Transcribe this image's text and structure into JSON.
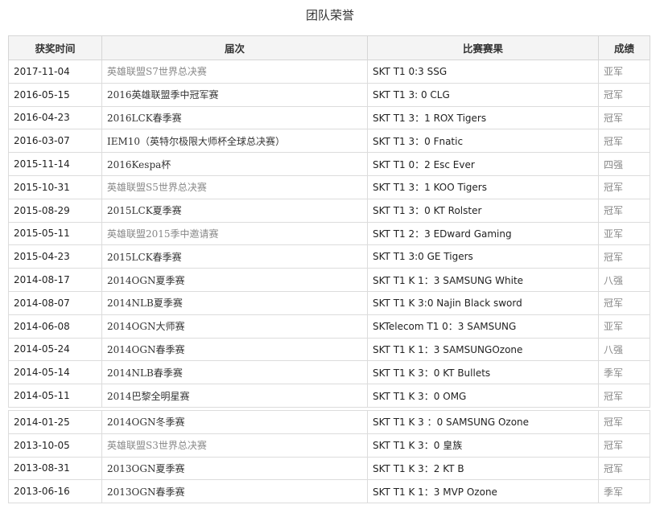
{
  "title": "团队荣誉",
  "headers": {
    "date": "获奖时间",
    "event": "届次",
    "match": "比赛赛果",
    "result": "成绩"
  },
  "rows": [
    {
      "date": "2017-11-04",
      "event": "英雄联盟S7世界总决赛",
      "match": "SKT T1 0:3 SSG",
      "result": "亚军"
    },
    {
      "date": "2016-05-15",
      "event": "2016英雄联盟季中冠军赛",
      "match": "SKT T1 3: 0 CLG",
      "result": "冠军"
    },
    {
      "date": "2016-04-23",
      "event": "2016LCK春季赛",
      "match": "SKT T1 3：1 ROX Tigers",
      "result": "冠军"
    },
    {
      "date": "2016-03-07",
      "event": "IEM10（英特尔极限大师杯全球总决赛）",
      "match": "SKT T1 3：0 Fnatic",
      "result": "冠军"
    },
    {
      "date": "2015-11-14",
      "event": "2016Kespa杯",
      "match": "SKT T1 0：2 Esc Ever",
      "result": "四强"
    },
    {
      "date": "2015-10-31",
      "event": "英雄联盟S5世界总决赛",
      "match": "SKT T1 3：1 KOO Tigers",
      "result": "冠军"
    },
    {
      "date": "2015-08-29",
      "event": "2015LCK夏季赛",
      "match": "SKT T1 3：0 KT Rolster",
      "result": "冠军"
    },
    {
      "date": "2015-05-11",
      "event": "英雄联盟2015季中邀请赛",
      "match": "SKT T1 2：3 EDward Gaming",
      "result": "亚军"
    },
    {
      "date": "2015-04-23",
      "event": "2015LCK春季赛",
      "match": "SKT T1 3:0 GE Tigers",
      "result": "冠军"
    },
    {
      "date": "2014-08-17",
      "event": "2014OGN夏季赛",
      "match": "SKT T1 K 1：3 SAMSUNG White",
      "result": "八强"
    },
    {
      "date": "2014-08-07",
      "event": "2014NLB夏季赛",
      "match": "SKT T1 K 3:0 Najin Black sword",
      "result": "冠军"
    },
    {
      "date": "2014-06-08",
      "event": "2014OGN大师赛",
      "match": "SKTelecom T1 0：3 SAMSUNG",
      "result": "亚军"
    },
    {
      "date": "2014-05-24",
      "event": "2014OGN春季赛",
      "match": "SKT T1 K 1：3 SAMSUNGOzone",
      "result": "八强"
    },
    {
      "date": "2014-05-14",
      "event": "2014NLB春季赛",
      "match": "SKT T1 K 3：0 KT Bullets",
      "result": "季军"
    },
    {
      "date": "2014-05-11",
      "event": "2014巴黎全明星赛",
      "match": "SKT T1 K 3：0 OMG",
      "result": "冠军"
    },
    {
      "date": "2014-01-25",
      "event": "2014OGN冬季赛",
      "match": "SKT T1 K 3 ：0 SAMSUNG Ozone",
      "result": "冠军"
    },
    {
      "date": "2013-10-05",
      "event": "英雄联盟S3世界总决赛",
      "match": "SKT T1 K 3：0 皇族",
      "result": "冠军"
    },
    {
      "date": "2013-08-31",
      "event": "2013OGN夏季赛",
      "match": "SKT T1 K 3：2 KT B",
      "result": "冠军"
    },
    {
      "date": "2013-06-16",
      "event": "2013OGN春季赛",
      "match": "SKT T1 K 1：3 MVP Ozone",
      "result": "季军"
    }
  ]
}
